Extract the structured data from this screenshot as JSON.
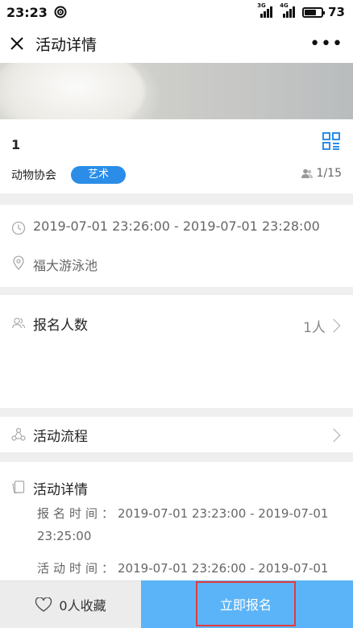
{
  "status_bar": {
    "time": "23:23",
    "signal_1_label": "3G",
    "signal_2_label": "4G",
    "battery": "73"
  },
  "header": {
    "title": "活动详情",
    "close_icon": "close-icon",
    "more_icon": "more-icon"
  },
  "activity": {
    "title": "1",
    "organizer": "动物协会",
    "category": "艺术",
    "capacity": "1/15",
    "time_range": "2019-07-01 23:26:00  -  2019-07-01 23:28:00",
    "location": "福大游泳池"
  },
  "signup": {
    "label": "报名人数",
    "count": "1人"
  },
  "flow": {
    "label": "活动流程"
  },
  "details": {
    "label": "活动详情",
    "signup_time_label": "报名时间：",
    "signup_time_line1": "2019-07-01  23:23:00  -  2019-07-01",
    "signup_time_line2": "23:25:00",
    "activity_time_label": "活动时间：",
    "activity_time_line1": "2019-07-01  23:26:00  -  2019-07-01"
  },
  "bottom": {
    "favorite_label": "0人收藏",
    "apply_label": "立即报名"
  },
  "colors": {
    "accent": "#2b8de8",
    "apply_bg": "#5cb4f8",
    "highlight": "#e23b3b"
  }
}
